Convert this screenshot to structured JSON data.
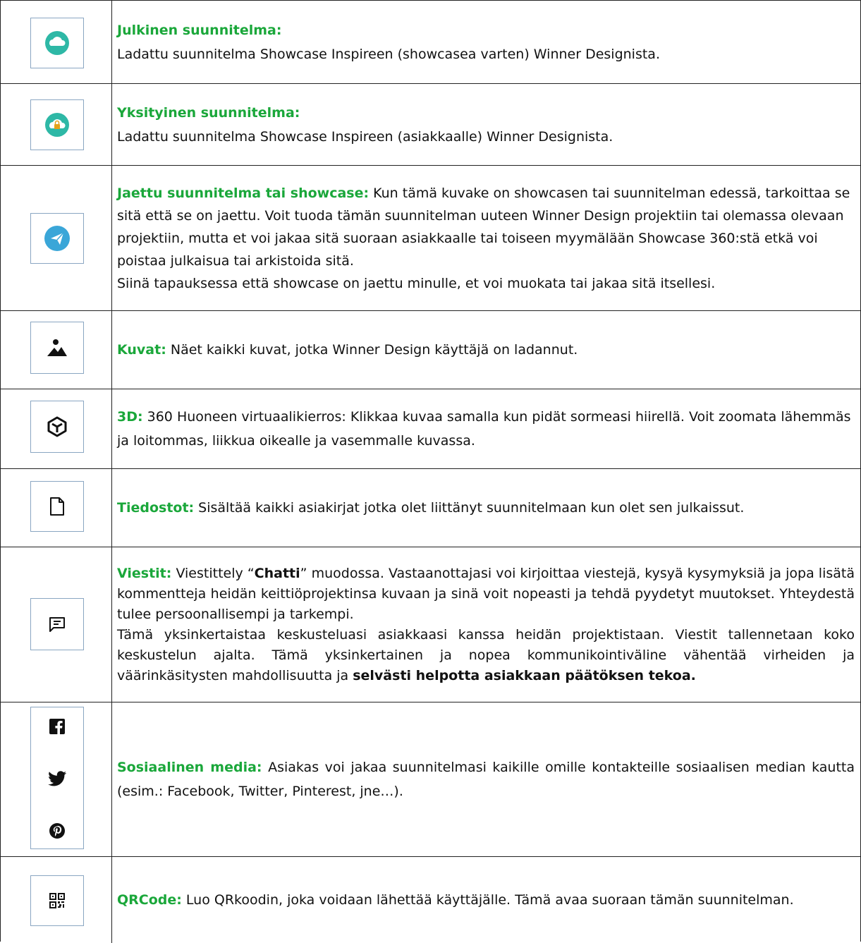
{
  "rows": [
    {
      "icon": "cloud-icon",
      "title": "Julkinen suunnitelma:",
      "text": "Ladattu suunnitelma Showcase Inspireen (showcasea varten) Winner Designista."
    },
    {
      "icon": "cloud-lock-icon",
      "title": "Yksityinen suunnitelma:",
      "text": "Ladattu suunnitelma Showcase Inspireen (asiakkaalle) Winner Designista."
    },
    {
      "icon": "shared-send-icon",
      "title": "Jaettu suunnitelma tai showcase:",
      "text": " Kun tämä kuvake on showcasen tai suunnitelman edessä, tarkoittaa se sitä että se on jaettu.  Voit tuoda tämän suunnitelman uuteen Winner Design projektiin tai olemassa olevaan projektiin, mutta et voi jakaa sitä suoraan asiakkaalle tai toiseen myymälään Showcase 360:stä etkä voi poistaa julkaisua tai arkistoida sitä.",
      "text2": "Siinä tapauksessa että showcase on jaettu minulle, et voi muokata tai jakaa sitä itsellesi."
    },
    {
      "icon": "image-icon",
      "title": "Kuvat:",
      "text": " Näet kaikki kuvat, jotka Winner Design käyttäjä on ladannut."
    },
    {
      "icon": "cube-3d-icon",
      "title": "3D:",
      "text": " 360 Huoneen virtuaalikierros: Klikkaa kuvaa samalla kun pidät sormeasi hiirellä. Voit zoomata lähemmäs ja loitommas, liikkua oikealle ja vasemmalle kuvassa."
    },
    {
      "icon": "file-icon",
      "title": "Tiedostot:",
      "text": " Sisältää kaikki asiakirjat jotka olet liittänyt suunnitelmaan kun olet sen julkaissut."
    },
    {
      "icon": "chat-icon",
      "title": "Viestit:",
      "text_a": " Viestittely “",
      "bold_a": "Chatti",
      "text_b": "” muodossa.  Vastaanottajasi voi kirjoittaa viestejä, kysyä kysymyksiä ja jopa lisätä kommentteja heidän keittiöprojektinsa kuvaan ja sinä voit nopeasti ja tehdä pyydetyt muutokset. Yhteydestä tulee persoonallisempi ja tarkempi.",
      "text_c": "Tämä yksinkertaistaa keskusteluasi asiakkaasi kanssa heidän projektistaan. Viestit tallennetaan koko keskustelun ajalta. Tämä yksinkertainen ja nopea kommunikointiväline vähentää virheiden ja väärinkäsitysten mahdollisuutta ja ",
      "bold_c": "selvästi helpotta asiakkaan päätöksen tekoa."
    },
    {
      "icons": [
        "facebook-icon",
        "twitter-icon",
        "pinterest-icon"
      ],
      "title": "Sosiaalinen media:",
      "text": " Asiakas voi jakaa suunnitelmasi kaikille omille kontakteille sosiaalisen median kautta (esim.: Facebook, Twitter, Pinterest, jne…)."
    },
    {
      "icon": "qr-code-icon",
      "title": "QRCode:",
      "text": " Luo QRkoodin, joka voidaan lähettää käyttäjälle. Tämä avaa suoraan tämän suunnitelman."
    }
  ],
  "colors": {
    "keyword": "#1aa73a",
    "icon_teal": "#2eb8a6",
    "icon_blue": "#3aa6d8"
  }
}
